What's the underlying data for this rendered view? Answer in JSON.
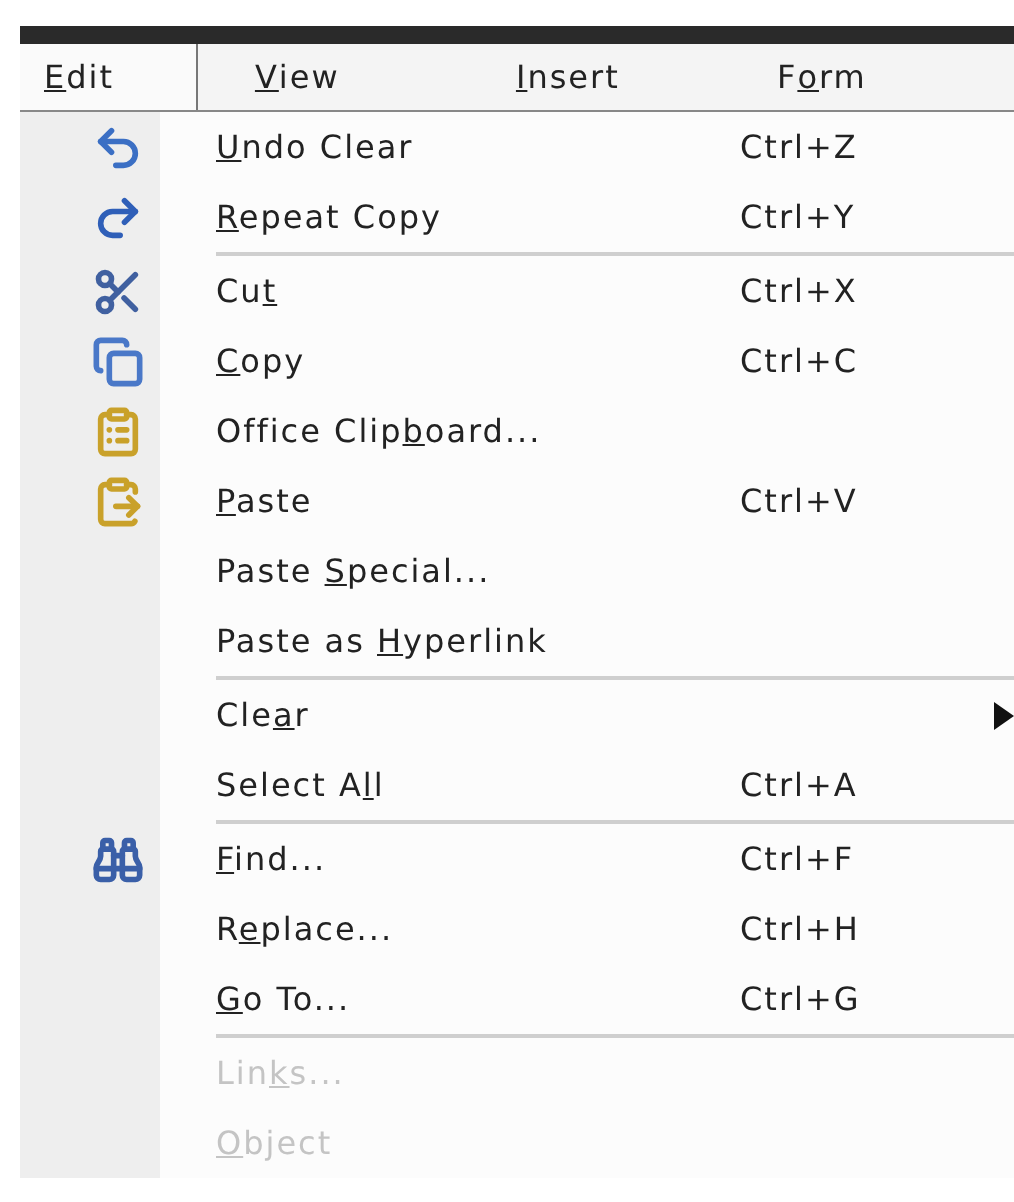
{
  "menubar": [
    {
      "key": "E",
      "post": "dit",
      "selected": true
    },
    {
      "key": "V",
      "post": "iew",
      "selected": false
    },
    {
      "key": "I",
      "post": "nsert",
      "selected": false
    },
    {
      "pre": "F",
      "key": "o",
      "post": "rm",
      "selected": false
    }
  ],
  "menu": [
    {
      "kind": "command",
      "key": "U",
      "post": "ndo Clear",
      "shortcut": "Ctrl+Z",
      "disabled": false,
      "submenu": false
    },
    {
      "kind": "command",
      "key": "R",
      "post": "epeat Copy",
      "shortcut": "Ctrl+Y",
      "disabled": false,
      "submenu": false
    },
    {
      "kind": "separator"
    },
    {
      "kind": "command",
      "pre": "Cu",
      "key": "t",
      "shortcut": "Ctrl+X",
      "disabled": false,
      "submenu": false
    },
    {
      "kind": "command",
      "key": "C",
      "post": "opy",
      "shortcut": "Ctrl+C",
      "disabled": false,
      "submenu": false
    },
    {
      "kind": "command",
      "pre": "Office Clip",
      "key": "b",
      "post": "oard...",
      "disabled": false,
      "submenu": false
    },
    {
      "kind": "command",
      "key": "P",
      "post": "aste",
      "shortcut": "Ctrl+V",
      "disabled": false,
      "submenu": false
    },
    {
      "kind": "command",
      "pre": "Paste ",
      "key": "S",
      "post": "pecial...",
      "disabled": false,
      "submenu": false
    },
    {
      "kind": "command",
      "pre": "Paste as ",
      "key": "H",
      "post": "yperlink",
      "disabled": false,
      "submenu": false
    },
    {
      "kind": "separator"
    },
    {
      "kind": "command",
      "pre": "Cle",
      "key": "a",
      "post": "r",
      "disabled": false,
      "submenu": true
    },
    {
      "kind": "command",
      "pre": "Select A",
      "key": "l",
      "post": "l",
      "shortcut": "Ctrl+A",
      "disabled": false,
      "submenu": false
    },
    {
      "kind": "separator"
    },
    {
      "kind": "command",
      "key": "F",
      "post": "ind...",
      "shortcut": "Ctrl+F",
      "disabled": false,
      "submenu": false
    },
    {
      "kind": "command",
      "pre": "R",
      "key": "e",
      "post": "place...",
      "shortcut": "Ctrl+H",
      "disabled": false,
      "submenu": false
    },
    {
      "kind": "command",
      "key": "G",
      "post": "o To...",
      "shortcut": "Ctrl+G",
      "disabled": false,
      "submenu": false
    },
    {
      "kind": "separator"
    },
    {
      "kind": "command",
      "pre": "Lin",
      "key": "k",
      "post": "s...",
      "disabled": true,
      "submenu": false
    },
    {
      "kind": "command",
      "key": "O",
      "post": "bject",
      "disabled": true,
      "submenu": false
    }
  ]
}
